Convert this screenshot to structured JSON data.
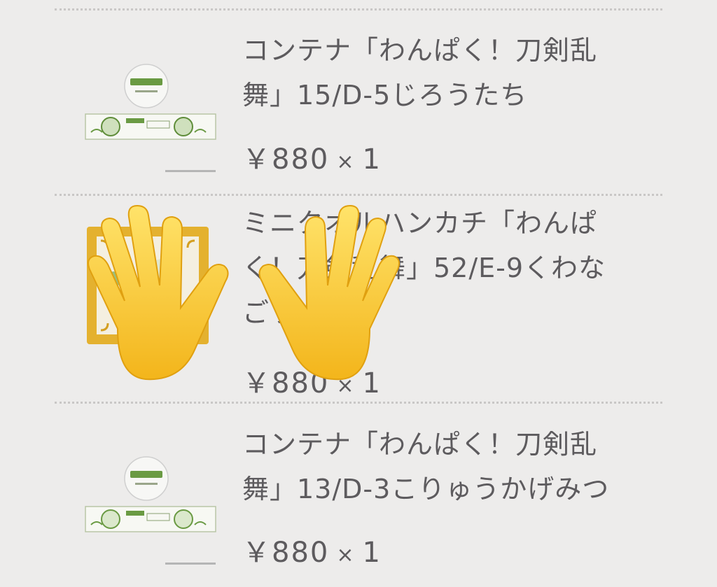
{
  "items": [
    {
      "title_line1": "コンテナ「わんぱく！刀剣乱",
      "title_line2": "舞」15/D-5じろうたち",
      "price": "￥880",
      "times": "×",
      "qty": "1"
    },
    {
      "title_line1": "ミニタオルハンカチ「わんぱ",
      "title_line2": "く！刀剣乱舞」52/E-9くわな",
      "title_line3": "ごう",
      "price": "￥880",
      "times": "×",
      "qty": "1"
    },
    {
      "title_line1": "コンテナ「わんぱく！刀剣乱",
      "title_line2": "舞」13/D-3こりゅうかげみつ",
      "price": "￥880",
      "times": "×",
      "qty": "1"
    }
  ],
  "colors": {
    "background": "#edeceb",
    "text": "#5d5b5e",
    "divider": "#c9c7c6",
    "green": "#6a9a43",
    "towel_gold": "#e4b12f"
  },
  "icons": {
    "overlay": "raised-hands-emoji"
  }
}
